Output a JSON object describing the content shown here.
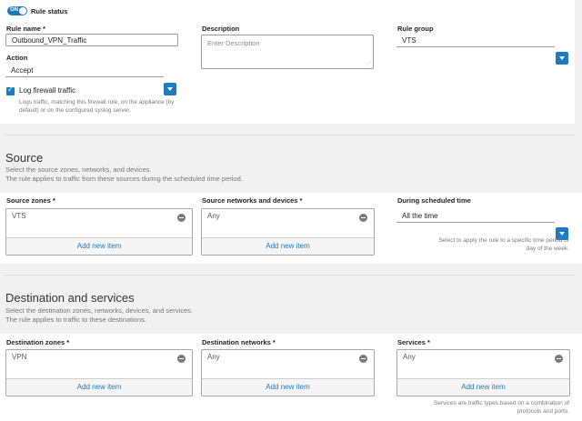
{
  "rule_status": {
    "toggle_text": "ON",
    "label": "Rule status"
  },
  "rule_name": {
    "label": "Rule name *",
    "value": "Outbound_VPN_Traffic"
  },
  "action": {
    "label": "Action",
    "value": "Accept"
  },
  "log_firewall": {
    "label": "Log firewall traffic",
    "hint_line1": "Logs traffic, matching this firewall rule, on the appliance (by",
    "hint_line2": "default) or on the configured syslog server."
  },
  "description": {
    "label": "Description",
    "placeholder": "Enter Description"
  },
  "rule_group": {
    "label": "Rule group",
    "value": "VTS"
  },
  "source": {
    "title": "Source",
    "desc_line1": "Select the source zones, networks, and devices.",
    "desc_line2": "The rule applies to traffic from these sources during the scheduled time period.",
    "zones": {
      "label": "Source zones *",
      "item": "VTS",
      "add": "Add new item"
    },
    "networks": {
      "label": "Source networks and devices *",
      "item": "Any",
      "add": "Add new item"
    },
    "schedule": {
      "label": "During scheduled time",
      "value": "All the time",
      "hint_line1": "Select to apply the rule to a specific time period or",
      "hint_line2": "day of the week."
    }
  },
  "destination": {
    "title": "Destination and services",
    "desc_line1": "Select the destination zones, networks, devices, and services.",
    "desc_line2": "The rule applies to traffic to these destinations.",
    "zones": {
      "label": "Destination zones *",
      "item": "VPN",
      "add": "Add new item"
    },
    "networks": {
      "label": "Destination networks *",
      "item": "Any",
      "add": "Add new item"
    },
    "services": {
      "label": "Services *",
      "item": "Any",
      "add": "Add new item",
      "hint_line1": "Services are traffic types based on a combination of",
      "hint_line2": "protocols and ports."
    }
  },
  "colors": {
    "accent": "#1d7bc2",
    "page_bg": "#f1f1f1"
  }
}
